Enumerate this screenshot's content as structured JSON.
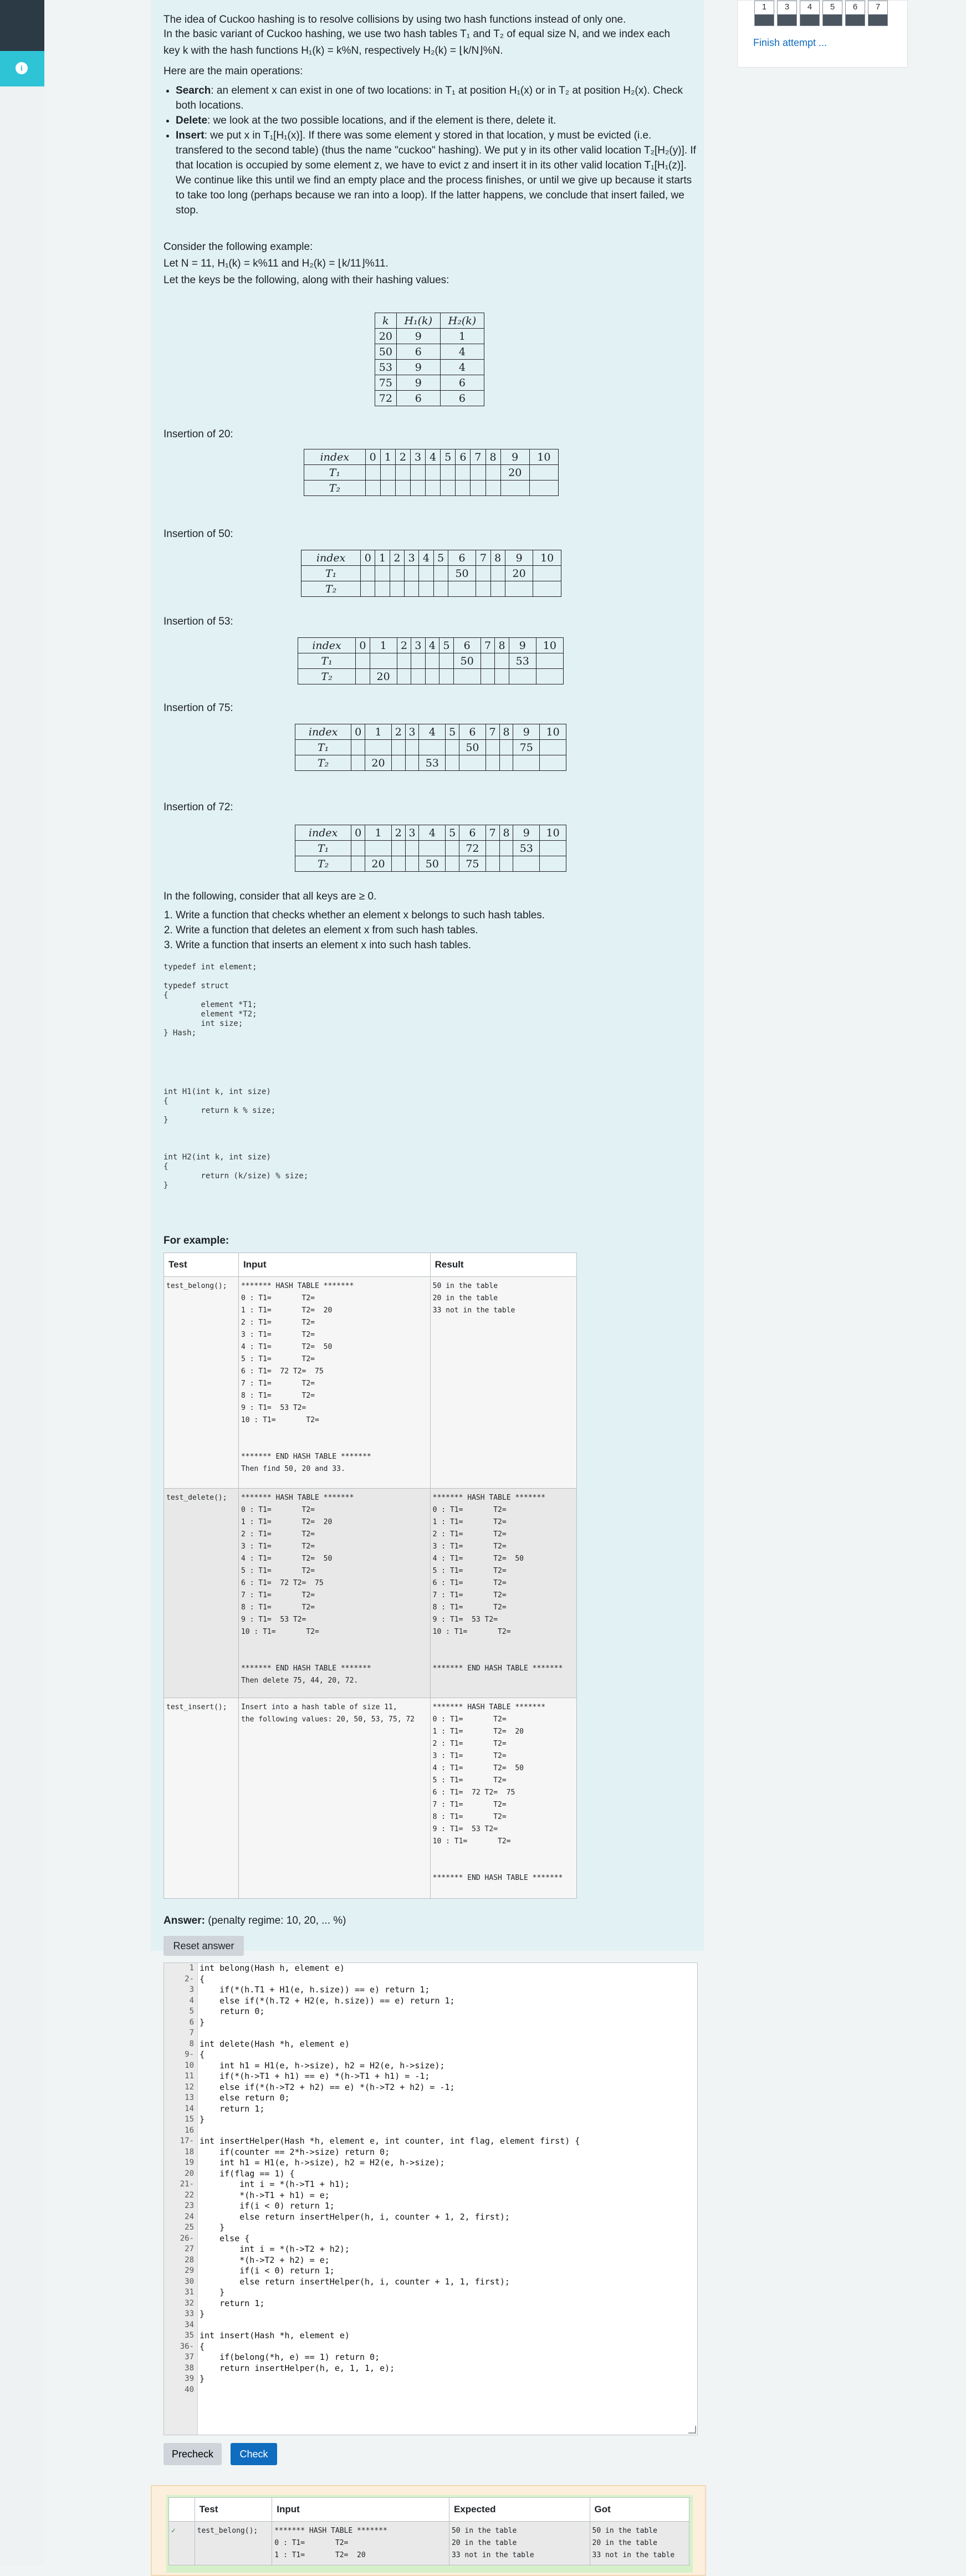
{
  "nav": {
    "boxes": [
      "1",
      "3",
      "4",
      "5",
      "6",
      "7"
    ],
    "finish_label": "Finish attempt ..."
  },
  "intro": {
    "p1": "The idea of Cuckoo hashing is to resolve collisions by using two hash functions instead of only one.",
    "p2a": "In the basic variant of Cuckoo hashing, we use two hash tables T₁ and T₂ of equal size N, and we index each",
    "p2b": "key k with the hash functions H₁(k) = k%N, respectively H₂(k) = ⌊k/N⌋%N.",
    "p3": "Here are the main operations:",
    "ops": [
      {
        "bold": "Search",
        "text": ": an element x can exist in one of two locations: in T₁ at position H₁(x) or in T₂ at position H₂(x). Check both locations."
      },
      {
        "bold": "Delete",
        "text": ": we look at the two possible locations, and if the element is there, delete it."
      },
      {
        "bold": "Insert",
        "text": ": we put x in T₁[H₁(x)]. If there was some element y stored in that location, y must be evicted (i.e. transfered to the second table) (thus the name \"cuckoo\" hashing). We put y in its other valid location T₂[H₂(y)]. If that location is occupied by some element z, we have to evict z and insert it in its other valid location T₁[H₁(z)]. We continue like this until we find an empty place and the process finishes, or until we give up because it starts to take too long (perhaps because we ran into a loop). If the latter happens, we conclude that insert failed, we stop."
      }
    ],
    "example_intro": "Consider the following example:",
    "example_let": "Let N = 11, H₁(k) = k%11 and H₂(k) = ⌊k/11⌋%11.",
    "example_keys": "Let the keys be the following, along with their hashing values:"
  },
  "keys_table": {
    "headers": [
      "k",
      "H₁(k)",
      "H₂(k)"
    ],
    "rows": [
      [
        "20",
        "9",
        "1"
      ],
      [
        "50",
        "6",
        "4"
      ],
      [
        "53",
        "9",
        "4"
      ],
      [
        "75",
        "9",
        "6"
      ],
      [
        "72",
        "6",
        "6"
      ]
    ]
  },
  "insertions": [
    {
      "label": "Insertion of 20:",
      "t1": [
        "",
        "",
        "",
        "",
        "",
        "",
        "",
        "",
        "",
        "20",
        ""
      ],
      "t2": [
        "",
        "",
        "",
        "",
        "",
        "",
        "",
        "",
        "",
        "",
        ""
      ]
    },
    {
      "label": "Insertion of 50:",
      "t1": [
        "",
        "",
        "",
        "",
        "",
        "",
        "50",
        "",
        "",
        "20",
        ""
      ],
      "t2": [
        "",
        "",
        "",
        "",
        "",
        "",
        "",
        "",
        "",
        "",
        ""
      ]
    },
    {
      "label": "Insertion of 53:",
      "t1": [
        "",
        "",
        "",
        "",
        "",
        "",
        "50",
        "",
        "",
        "53",
        ""
      ],
      "t2": [
        "",
        "20",
        "",
        "",
        "",
        "",
        "",
        "",
        "",
        "",
        ""
      ]
    },
    {
      "label": "Insertion of 75:",
      "t1": [
        "",
        "",
        "",
        "",
        "",
        "",
        "50",
        "",
        "",
        "75",
        ""
      ],
      "t2": [
        "",
        "20",
        "",
        "",
        "53",
        "",
        "",
        "",
        "",
        "",
        ""
      ]
    },
    {
      "label": "Insertion of 72:",
      "t1": [
        "",
        "",
        "",
        "",
        "",
        "",
        "72",
        "",
        "",
        "53",
        ""
      ],
      "t2": [
        "",
        "20",
        "",
        "",
        "50",
        "",
        "75",
        "",
        "",
        "",
        ""
      ]
    }
  ],
  "index_label": "index",
  "t1_label": "T₁",
  "t2_label": "T₂",
  "keys_note": "In the following, consider that all keys are ≥ 0.",
  "tasks": [
    "Write a function that checks whether an element x belongs to such hash tables.",
    "Write a function that deletes an element x from such hash tables.",
    "Write a function that inserts an element x into such hash tables."
  ],
  "code_typedefs": "typedef int element;\n\ntypedef struct\n{\n        element *T1;\n        element *T2;\n        int size;\n} Hash;",
  "code_h1": "int H1(int k, int size)\n{\n        return k % size;\n}",
  "code_h2": "int H2(int k, int size)\n{\n        return (k/size) % size;\n}",
  "example": {
    "title": "For example:",
    "headers": [
      "Test",
      "Input",
      "Result"
    ],
    "rows": [
      {
        "test": "test_belong();",
        "input": "******* HASH TABLE *******\n0 : T1=       T2=\n1 : T1=       T2=  20\n2 : T1=       T2=\n3 : T1=       T2=\n4 : T1=       T2=  50\n5 : T1=       T2=\n6 : T1=  72 T2=  75\n7 : T1=       T2=\n8 : T1=       T2=\n9 : T1=  53 T2=\n10 : T1=       T2=\n\n\n******* END HASH TABLE *******\nThen find 50, 20 and 33.",
        "result": "50 in the table\n20 in the table\n33 not in the table"
      },
      {
        "test": "test_delete();",
        "input": "******* HASH TABLE *******\n0 : T1=       T2=\n1 : T1=       T2=  20\n2 : T1=       T2=\n3 : T1=       T2=\n4 : T1=       T2=  50\n5 : T1=       T2=\n6 : T1=  72 T2=  75\n7 : T1=       T2=\n8 : T1=       T2=\n9 : T1=  53 T2=\n10 : T1=       T2=\n\n\n******* END HASH TABLE *******\nThen delete 75, 44, 20, 72.",
        "result": "******* HASH TABLE *******\n0 : T1=       T2=\n1 : T1=       T2=\n2 : T1=       T2=\n3 : T1=       T2=\n4 : T1=       T2=  50\n5 : T1=       T2=\n6 : T1=       T2=\n7 : T1=       T2=\n8 : T1=       T2=\n9 : T1=  53 T2=\n10 : T1=       T2=\n\n\n******* END HASH TABLE *******"
      },
      {
        "test": "test_insert();",
        "input": "Insert into a hash table of size 11,\nthe following values: 20, 50, 53, 75, 72",
        "result": "******* HASH TABLE *******\n0 : T1=       T2=\n1 : T1=       T2=  20\n2 : T1=       T2=\n3 : T1=       T2=\n4 : T1=       T2=  50\n5 : T1=       T2=\n6 : T1=  72 T2=  75\n7 : T1=       T2=\n8 : T1=       T2=\n9 : T1=  53 T2=\n10 : T1=       T2=\n\n\n******* END HASH TABLE *******"
      }
    ]
  },
  "answer": {
    "label": "Answer:",
    "penalty": "(penalty regime: 10, 20, ... %)",
    "reset_label": "Reset answer",
    "line_numbers": [
      "1",
      "2-",
      "3",
      "4",
      "5",
      "6",
      "7",
      "8",
      "9-",
      "10",
      "11",
      "12",
      "13",
      "14",
      "15",
      "16",
      "17-",
      "18",
      "19",
      "20",
      "21-",
      "22",
      "23",
      "24",
      "25",
      "26-",
      "27",
      "28",
      "29",
      "30",
      "31",
      "32",
      "33",
      "34",
      "35",
      "36-",
      "37",
      "38",
      "39",
      "40"
    ],
    "code_lines": [
      "int belong(Hash h, element e)",
      "{",
      "    if(*(h.T1 + H1(e, h.size)) == e) return 1;",
      "    else if(*(h.T2 + H2(e, h.size)) == e) return 1;",
      "    return 0;",
      "}",
      "",
      "int delete(Hash *h, element e)",
      "{",
      "    int h1 = H1(e, h->size), h2 = H2(e, h->size);",
      "    if(*(h->T1 + h1) == e) *(h->T1 + h1) = -1;",
      "    else if(*(h->T2 + h2) == e) *(h->T2 + h2) = -1;",
      "    else return 0;",
      "    return 1;",
      "}",
      "",
      "int insertHelper(Hash *h, element e, int counter, int flag, element first) {",
      "    if(counter == 2*h->size) return 0;",
      "    int h1 = H1(e, h->size), h2 = H2(e, h->size);",
      "    if(flag == 1) {",
      "        int i = *(h->T1 + h1);",
      "        *(h->T1 + h1) = e;",
      "        if(i < 0) return 1;",
      "        else return insertHelper(h, i, counter + 1, 2, first);",
      "    }",
      "    else {",
      "        int i = *(h->T2 + h2);",
      "        *(h->T2 + h2) = e;",
      "        if(i < 0) return 1;",
      "        else return insertHelper(h, i, counter + 1, 1, first);",
      "    }",
      "    return 1;",
      "}",
      "",
      "int insert(Hash *h, element e)",
      "{",
      "    if(belong(*h, e) == 1) return 0;",
      "    return insertHelper(h, e, 1, 1, e);",
      "}",
      ""
    ],
    "precheck_label": "Precheck",
    "check_label": "Check"
  },
  "results": {
    "headers": [
      "",
      "Test",
      "Input",
      "Expected",
      "Got"
    ],
    "row": {
      "status": "✓",
      "test": "test_belong();",
      "input": "******* HASH TABLE *******\n0 : T1=       T2=\n1 : T1=       T2=  20",
      "expected": "50 in the table\n20 in the table\n33 not in the table",
      "got": "50 in the table\n20 in the table\n33 not in the table"
    }
  }
}
